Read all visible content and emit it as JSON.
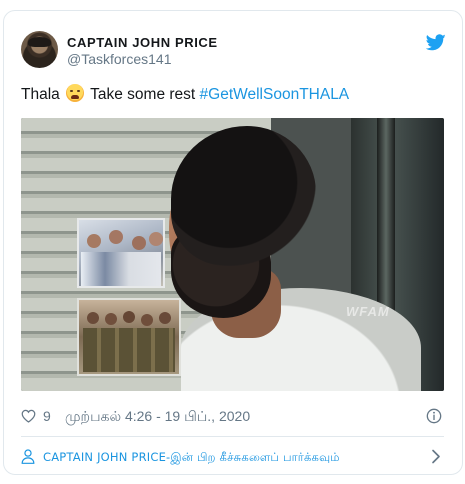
{
  "author": {
    "display_name": "CAPTAIN JOHN PRICE",
    "handle": "@Taskforces141"
  },
  "tweet": {
    "text_before": "Thala",
    "emoji": "crying-face",
    "text_after": " Take some rest ",
    "hashtag": "#GetWellSoonTHALA"
  },
  "media": {
    "watermark": "WFAM"
  },
  "meta": {
    "like_count": "9",
    "timestamp": "முற்பகல் 4:26 - 19 பிப்., 2020"
  },
  "footer": {
    "link_text": "CAPTAIN JOHN PRICE-இன் பிற கீச்சுகளைப் பார்க்கவும்"
  },
  "colors": {
    "accent": "#1b95e0",
    "secondary_text": "#657786",
    "border": "#e1e8ed"
  },
  "icons": [
    "twitter-logo-icon",
    "heart-icon",
    "info-icon",
    "person-icon",
    "chevron-right-icon"
  ]
}
